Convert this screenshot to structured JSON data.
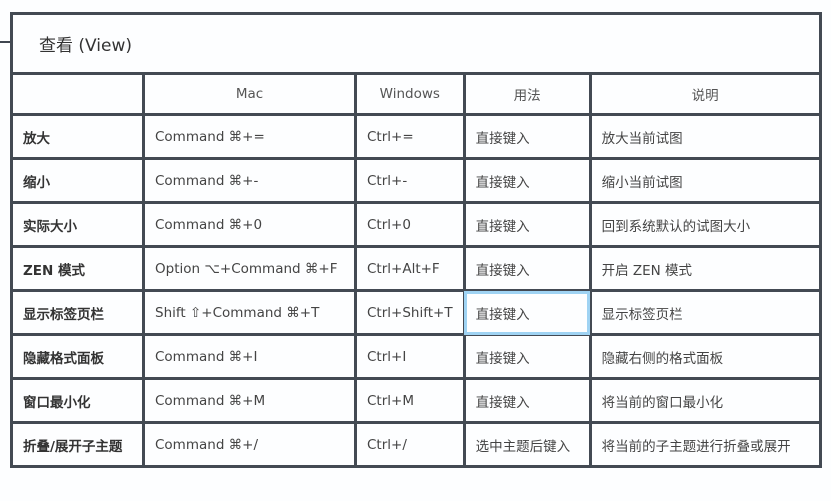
{
  "title": "查看 (View)",
  "columns": [
    "",
    "Mac",
    "Windows",
    "用法",
    "说明"
  ],
  "rows": [
    {
      "action": "放大",
      "mac": "Command ⌘+=",
      "windows": "Ctrl+=",
      "usage": "直接键入",
      "description": "放大当前试图"
    },
    {
      "action": "缩小",
      "mac": "Command ⌘+-",
      "windows": "Ctrl+-",
      "usage": "直接键入",
      "description": "缩小当前试图"
    },
    {
      "action": "实际大小",
      "mac": "Command ⌘+0",
      "windows": "Ctrl+0",
      "usage": "直接键入",
      "description": "回到系统默认的试图大小"
    },
    {
      "action": "ZEN 模式",
      "mac": "Option ⌥+Command ⌘+F",
      "windows": "Ctrl+Alt+F",
      "usage": "直接键入",
      "description": "开启 ZEN 模式"
    },
    {
      "action": "显示标签页栏",
      "mac": "Shift ⇧+Command ⌘+T",
      "windows": "Ctrl+Shift+T",
      "usage": "直接键入",
      "description": "显示标签页栏"
    },
    {
      "action": "隐藏格式面板",
      "mac": "Command ⌘+I",
      "windows": "Ctrl+I",
      "usage": "直接键入",
      "description": "隐藏右侧的格式面板"
    },
    {
      "action": "窗口最小化",
      "mac": "Command ⌘+M",
      "windows": "Ctrl+M",
      "usage": "直接键入",
      "description": "将当前的窗口最小化"
    },
    {
      "action": "折叠/展开子主题",
      "mac": "Command ⌘+/",
      "windows": "Ctrl+/",
      "usage": "选中主题后键入",
      "description": "将当前的子主题进行折叠或展开"
    }
  ],
  "selected_cell": {
    "row": 4,
    "column": "usage"
  },
  "colors": {
    "border": "#434a53",
    "selection": "#9fd3f3"
  }
}
